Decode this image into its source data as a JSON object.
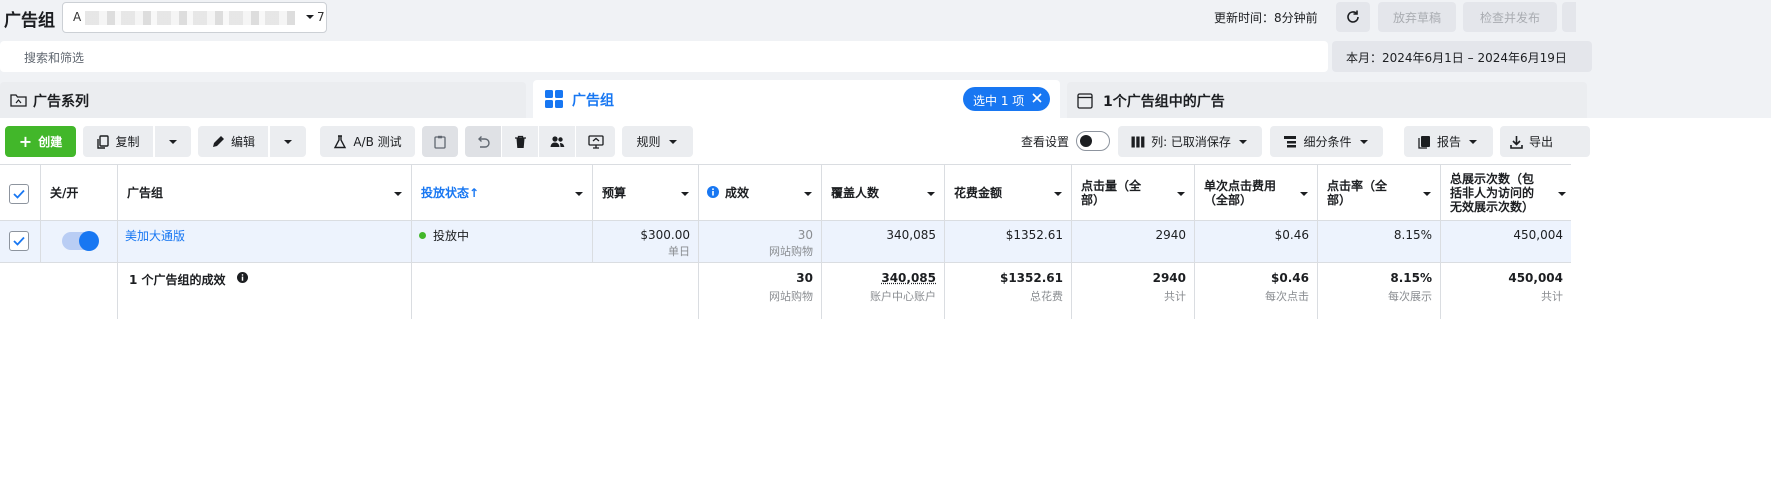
{
  "header": {
    "title": "广告组",
    "account": {
      "prefix": "A",
      "suffix": "7"
    },
    "updated": "更新时间：8分钟前",
    "discard_label": "放弃草稿",
    "publish_label": "检查并发布"
  },
  "search": {
    "placeholder": "搜索和筛选"
  },
  "date_range": "本月：2024年6月1日 – 2024年6月19日",
  "tabs": {
    "campaign": "广告系列",
    "adset": "广告组",
    "selected_pill": "选中 1 项",
    "ads": "1个广告组中的广告"
  },
  "toolbar": {
    "create": "创建",
    "copy": "复制",
    "edit": "编辑",
    "ab_test": "A/B 测试",
    "rules": "规则",
    "view_settings": "查看设置",
    "columns": "列: 已取消保存",
    "breakdown": "细分条件",
    "reports": "报告",
    "export": "导出"
  },
  "table": {
    "headers": {
      "on_off": "关/开",
      "adset": "广告组",
      "delivery": "投放状态↑",
      "budget": "预算",
      "results": "成效",
      "reach": "覆盖人数",
      "spend": "花费金额",
      "clicks_l1": "点击量（全",
      "clicks_l2": "部）",
      "cpc_l1": "单次点击费用",
      "cpc_l2": "（全部）",
      "ctr_l1": "点击率（全",
      "ctr_l2": "部）",
      "impr_l1": "总展示次数（包",
      "impr_l2": "括非人为访问的",
      "impr_l3": "无效展示次数）"
    },
    "row": {
      "name": "美加大通版",
      "status": "投放中",
      "budget": "$300.00",
      "budget_sub": "单日",
      "results": "30",
      "results_sub": "网站购物",
      "reach": "340,085",
      "spend": "$1352.61",
      "clicks": "2940",
      "cpc": "$0.46",
      "ctr": "8.15%",
      "impressions": "450,004"
    },
    "footer": {
      "label": "1 个广告组的成效",
      "results": "30",
      "results_sub": "网站购物",
      "reach": "340,085",
      "reach_sub": "账户中心账户",
      "spend": "$1352.61",
      "spend_sub": "总花费",
      "clicks": "2940",
      "clicks_sub": "共计",
      "cpc": "$0.46",
      "cpc_sub": "每次点击",
      "ctr": "8.15%",
      "ctr_sub": "每次展示",
      "impressions": "450,004",
      "impressions_sub": "共计"
    }
  },
  "colors": {
    "accent": "#1877f2",
    "create": "#42b72a",
    "status_active": "#42b72a"
  }
}
